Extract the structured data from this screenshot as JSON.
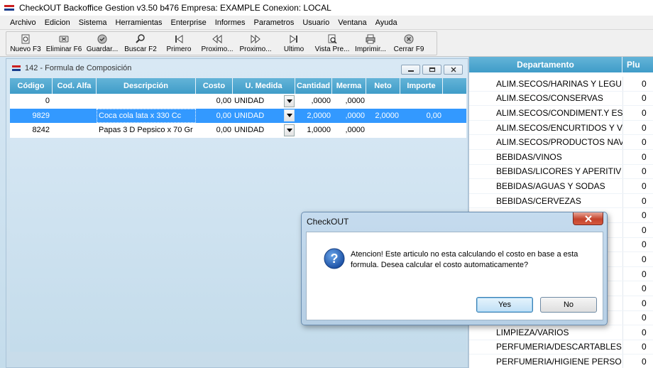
{
  "app": {
    "title": "CheckOUT Backoffice Gestion v3.50 b476 Empresa: EXAMPLE Conexion: LOCAL"
  },
  "menu": [
    "Archivo",
    "Edicion",
    "Sistema",
    "Herramientas",
    "Enterprise",
    "Informes",
    "Parametros",
    "Usuario",
    "Ventana",
    "Ayuda"
  ],
  "toolbar": [
    {
      "label": "Nuevo F3",
      "icon": "new-icon"
    },
    {
      "label": "Eliminar F6",
      "icon": "delete-icon"
    },
    {
      "label": "Guardar...",
      "icon": "save-icon"
    },
    {
      "label": "Buscar F2",
      "icon": "search-icon"
    },
    {
      "label": "Primero",
      "icon": "first-icon"
    },
    {
      "label": "Proximo...",
      "icon": "previous-icon"
    },
    {
      "label": "Proximo...",
      "icon": "next-icon"
    },
    {
      "label": "Ultimo",
      "icon": "last-icon"
    },
    {
      "label": "Vista Pre...",
      "icon": "preview-icon"
    },
    {
      "label": "Imprimir...",
      "icon": "print-icon"
    },
    {
      "label": "Cerrar F9",
      "icon": "close-icon"
    }
  ],
  "formula_window": {
    "title": "142 - Formula de Composición",
    "columns": [
      "Código",
      "Cod. Alfa",
      "Descripción",
      "Costo",
      "U. Medida",
      "Cantidad",
      "Merma",
      "Neto",
      "Importe"
    ],
    "rows": [
      {
        "codigo": "0",
        "cod_alfa": "",
        "descripcion": "",
        "costo": "0,00",
        "unidad": "UNIDAD",
        "cantidad": ",0000",
        "merma": ",0000",
        "neto": "",
        "importe": ""
      },
      {
        "codigo": "9829",
        "cod_alfa": "",
        "descripcion": "Coca cola lata x 330 Cc",
        "costo": "0,00",
        "unidad": "UNIDAD",
        "cantidad": "2,0000",
        "merma": ",0000",
        "neto": "2,0000",
        "importe": "0,00",
        "selected": true
      },
      {
        "codigo": "8242",
        "cod_alfa": "",
        "descripcion": "Papas 3 D Pepsico x 70 Gr",
        "costo": "0,00",
        "unidad": "UNIDAD",
        "cantidad": "1,0000",
        "merma": ",0000",
        "neto": "",
        "importe": ""
      }
    ]
  },
  "departments": {
    "columns": [
      "Departamento",
      "Plu"
    ],
    "rows": [
      {
        "name": "ALIM.SECOS/HARINAS Y LEGU",
        "plu": "0"
      },
      {
        "name": "ALIM.SECOS/CONSERVAS",
        "plu": "0"
      },
      {
        "name": "ALIM.SECOS/CONDIMENT.Y ES",
        "plu": "0"
      },
      {
        "name": "ALIM.SECOS/ENCURTIDOS Y V",
        "plu": "0"
      },
      {
        "name": "ALIM.SECOS/PRODUCTOS NAV",
        "plu": "0"
      },
      {
        "name": "BEBIDAS/VINOS",
        "plu": "0"
      },
      {
        "name": "BEBIDAS/LICORES Y APERITIV",
        "plu": "0"
      },
      {
        "name": "BEBIDAS/AGUAS Y SODAS",
        "plu": "0"
      },
      {
        "name": "BEBIDAS/CERVEZAS",
        "plu": "0"
      },
      {
        "name": "",
        "plu": "0"
      },
      {
        "name": "",
        "plu": "0"
      },
      {
        "name": "MAN",
        "plu": "0"
      },
      {
        "name": "PA",
        "plu": "0"
      },
      {
        "name": "",
        "plu": "0"
      },
      {
        "name": "",
        "plu": "0"
      },
      {
        "name": "MBIE",
        "plu": "0"
      },
      {
        "name": "",
        "plu": "0"
      },
      {
        "name": "LIMPIEZA/VARIOS",
        "plu": "0"
      },
      {
        "name": "PERFUMERIA/DESCARTABLES",
        "plu": "0"
      },
      {
        "name": "PERFUMERIA/HIGIENE PERSO",
        "plu": "0"
      }
    ]
  },
  "dialog": {
    "title": "CheckOUT",
    "message": "Atencion! Este articulo no esta calculando el costo en base a esta formula. Desea calcular el costo automaticamente?",
    "yes": "Yes",
    "no": "No"
  }
}
